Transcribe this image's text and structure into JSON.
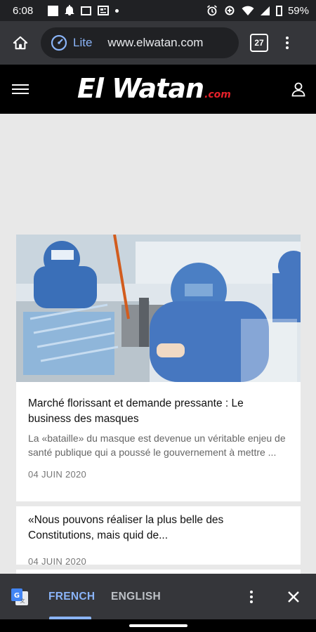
{
  "status_bar": {
    "time": "6:08",
    "battery": "59%"
  },
  "browser": {
    "mode_label": "Lite",
    "url": "www.elwatan.com",
    "tab_count": "27",
    "accent_color": "#8ab4f8"
  },
  "site": {
    "logo_main": "El Watan",
    "logo_suffix": ".com",
    "logo_suffix_color": "#e4202a"
  },
  "articles": [
    {
      "title": "Marché florissant et demande pressante : Le business des masques",
      "excerpt": "La «bataille» du masque est devenue un véritable enjeu de santé publique qui a poussé le gouvernement à mettre ...",
      "date": "04 JUIN 2020"
    },
    {
      "title": "«Nous pouvons réaliser la plus belle des Constitutions, mais quid de...",
      "date": "04 JUIN 2020"
    }
  ],
  "translate_bar": {
    "active_language": "FRENCH",
    "other_language": "ENGLISH"
  },
  "icons": {
    "home": "home-icon",
    "lite": "lite-mode-icon",
    "menu": "overflow-menu-icon",
    "hamburger": "hamburger-menu-icon",
    "user": "user-icon",
    "translate": "google-translate-icon",
    "close": "close-icon"
  }
}
